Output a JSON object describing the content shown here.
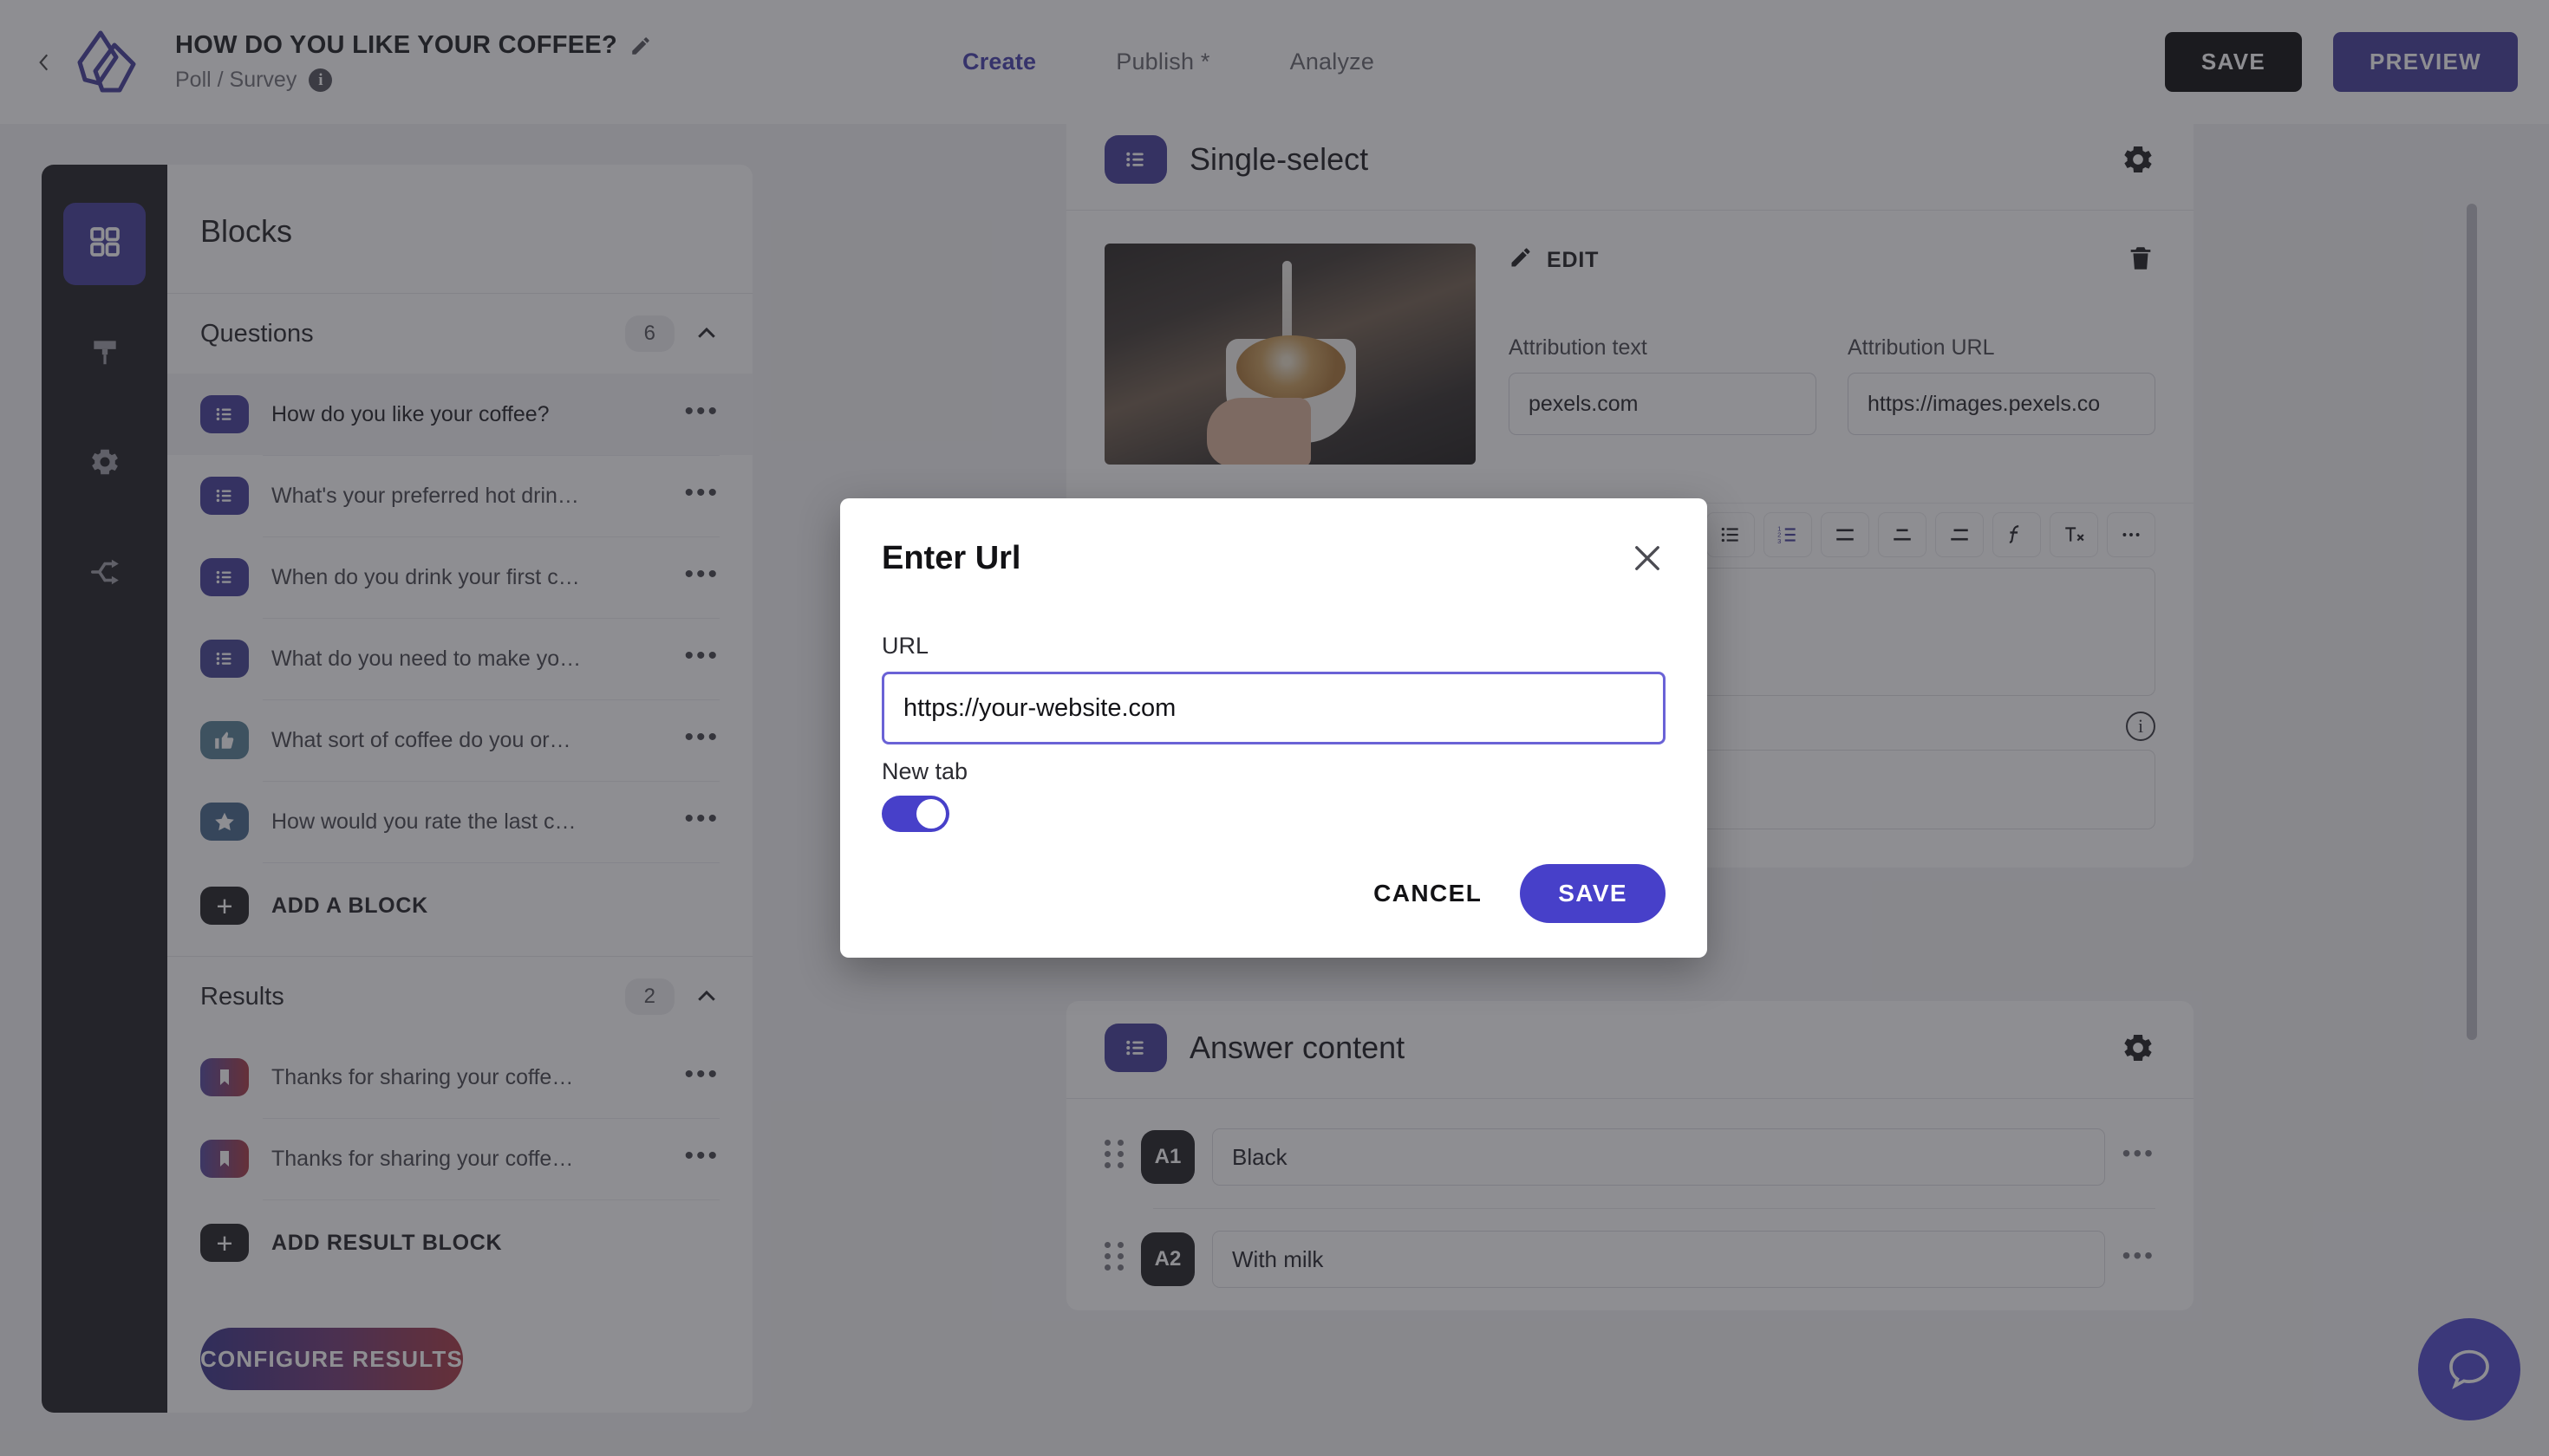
{
  "topbar": {
    "back_icon": "chevron-left-icon",
    "logo_icon": "brand-logo-icon",
    "title": "HOW DO YOU LIKE YOUR COFFEE?",
    "title_edit_icon": "pencil-icon",
    "subtitle": "Poll / Survey",
    "subtitle_info_icon": "info-icon",
    "tabs": [
      {
        "label": "Create",
        "active": true
      },
      {
        "label": "Publish *",
        "active": false
      },
      {
        "label": "Analyze",
        "active": false
      }
    ],
    "save_label": "SAVE",
    "preview_label": "PREVIEW"
  },
  "rail": {
    "items": [
      {
        "icon": "grid-blocks-icon",
        "active": true
      },
      {
        "icon": "paint-brush-icon",
        "active": false
      },
      {
        "icon": "gear-icon",
        "active": false
      },
      {
        "icon": "share-branch-icon",
        "active": false
      }
    ]
  },
  "blocks_panel": {
    "title": "Blocks",
    "questions": {
      "label": "Questions",
      "count": "6",
      "collapse_icon": "chevron-up-icon",
      "items": [
        {
          "label": "How do you like your coffee?",
          "icon": "list-icon",
          "color": "#3b3496",
          "selected": true
        },
        {
          "label": "What's your preferred hot drin…",
          "icon": "list-icon",
          "color": "#3b3496",
          "selected": false
        },
        {
          "label": "When do you drink your first c…",
          "icon": "list-icon",
          "color": "#3b3496",
          "selected": false
        },
        {
          "label": "What do you need to make yo…",
          "icon": "list-icon",
          "color": "#3b3a8e",
          "selected": false
        },
        {
          "label": "What sort of coffee do you or…",
          "icon": "thumbs-up-icon",
          "color": "#4e7b90",
          "selected": false
        },
        {
          "label": "How would you rate the last c…",
          "icon": "star-icon",
          "color": "#3c5f85",
          "selected": false
        }
      ],
      "add_label": "ADD A BLOCK",
      "add_icon": "plus-icon"
    },
    "results": {
      "label": "Results",
      "count": "2",
      "collapse_icon": "chevron-up-icon",
      "items": [
        {
          "label": "Thanks for sharing your coffe…",
          "icon": "bookmark-icon"
        },
        {
          "label": "Thanks for sharing your coffe…",
          "icon": "bookmark-icon"
        }
      ],
      "add_label": "ADD RESULT BLOCK",
      "add_icon": "plus-icon"
    },
    "configure_label": "CONFIGURE RESULTS",
    "row_menu_icon": "ellipsis-icon"
  },
  "editor": {
    "header_title": "Single-select",
    "header_icon": "list-icon",
    "header_action_icon": "gear-icon",
    "image_alt": "coffee-latte-pour-photo",
    "edit_label": "EDIT",
    "edit_icon": "pencil-icon",
    "delete_icon": "trash-icon",
    "attribution_text_label": "Attribution text",
    "attribution_text_value": "pexels.com",
    "attribution_url_label": "Attribution URL",
    "attribution_url_value": "https://images.pexels.co",
    "toolbar": [
      {
        "icon": "emoji-icon",
        "active": false
      },
      {
        "icon": "bullet-list-icon",
        "active": false
      },
      {
        "icon": "numbered-list-icon",
        "active": true
      },
      {
        "icon": "align-left-icon",
        "active": false
      },
      {
        "icon": "align-center-icon",
        "active": false
      },
      {
        "icon": "align-right-icon",
        "active": false
      },
      {
        "icon": "formula-icon",
        "active": false
      },
      {
        "icon": "clear-format-icon",
        "active": false
      },
      {
        "icon": "more-options-icon",
        "active": false
      }
    ],
    "info_icon": "info-circle-icon"
  },
  "answer": {
    "header_title": "Answer content",
    "header_icon": "list-icon",
    "header_action_icon": "gear-icon",
    "rows": [
      {
        "tag": "A1",
        "value": "Black",
        "menu_icon": "ellipsis-icon",
        "grip_icon": "drag-handle-icon"
      },
      {
        "tag": "A2",
        "value": "With milk",
        "menu_icon": "ellipsis-icon",
        "grip_icon": "drag-handle-icon"
      }
    ]
  },
  "fab": {
    "icon": "chat-bubble-icon"
  },
  "modal": {
    "title": "Enter Url",
    "close_icon": "close-icon",
    "url_label": "URL",
    "url_value": "https://your-website.com",
    "url_placeholder": "https://your-website.com",
    "newtab_label": "New tab",
    "newtab_on": true,
    "cancel_label": "CANCEL",
    "save_label": "SAVE"
  },
  "colors": {
    "accent": "#4740c9",
    "brand": "#3b3496",
    "dark": "#161619",
    "gradient_start": "#2f2a85",
    "gradient_end": "#a5303a"
  }
}
